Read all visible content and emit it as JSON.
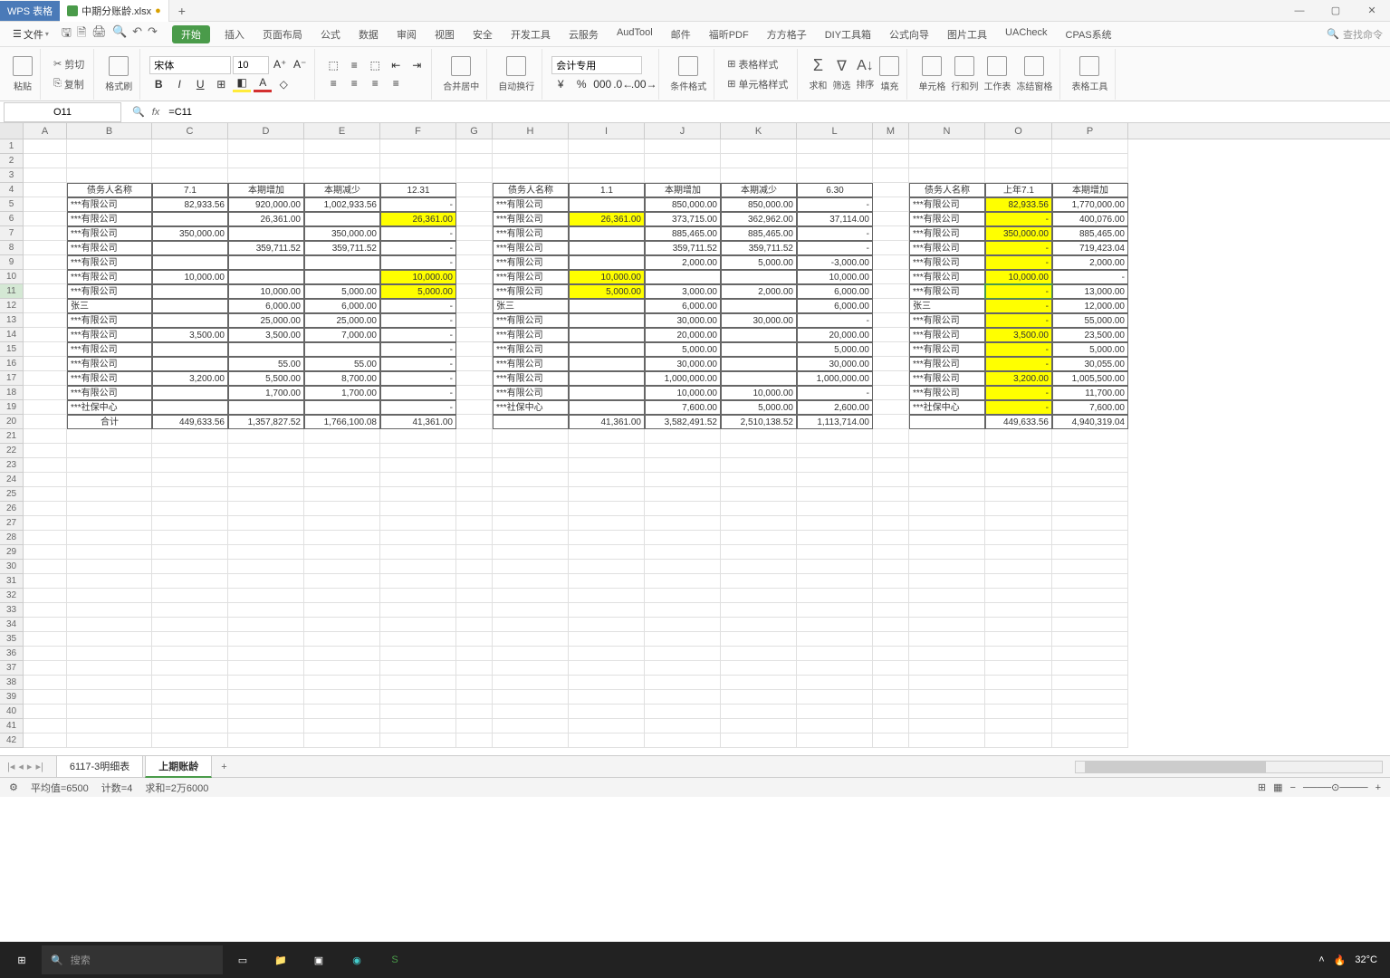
{
  "app": {
    "name": "WPS 表格",
    "file": "中期分账龄.xlsx"
  },
  "menu": {
    "file": "文件",
    "tabs": [
      "开始",
      "插入",
      "页面布局",
      "公式",
      "数据",
      "审阅",
      "视图",
      "安全",
      "开发工具",
      "云服务",
      "AudTool",
      "邮件",
      "福昕PDF",
      "方方格子",
      "DIY工具箱",
      "公式向导",
      "图片工具",
      "UACheck",
      "CPAS系统"
    ],
    "active": 0,
    "search": "查找命令"
  },
  "ribbon": {
    "paste": "粘贴",
    "cut": "剪切",
    "copy": "复制",
    "fmtpaint": "格式刷",
    "font_name": "宋体",
    "font_size": "10",
    "merge": "合并居中",
    "wrap": "自动换行",
    "num_fmt": "会计专用",
    "cond": "条件格式",
    "tblsty": "表格样式",
    "cellsty": "单元格样式",
    "sum": "求和",
    "filter": "筛选",
    "sort": "排序",
    "fill": "填充",
    "cell": "单元格",
    "rowcol": "行和列",
    "sheet": "工作表",
    "freeze": "冻结窗格",
    "tbltools": "表格工具"
  },
  "namebox": "O11",
  "formula": "=C11",
  "cols": [
    "A",
    "B",
    "C",
    "D",
    "E",
    "F",
    "G",
    "H",
    "I",
    "J",
    "K",
    "L",
    "M",
    "N",
    "O",
    "P"
  ],
  "rows": 42,
  "activeRow": 11,
  "hdr1": {
    "B": "债务人名称",
    "C": "7.1",
    "D": "本期增加",
    "E": "本期减少",
    "F": "12.31"
  },
  "hdr2": {
    "H": "债务人名称",
    "I": "1.1",
    "J": "本期增加",
    "K": "本期减少",
    "L": "6.30"
  },
  "hdr3": {
    "N": "债务人名称",
    "O": "上年7.1",
    "P": "本期增加"
  },
  "t1": [
    {
      "b": "***有限公司",
      "c": "82,933.56",
      "d": "920,000.00",
      "e": "1,002,933.56",
      "f": "-"
    },
    {
      "b": "***有限公司",
      "c": "",
      "d": "26,361.00",
      "e": "",
      "f": "26,361.00",
      "fy": true
    },
    {
      "b": "***有限公司",
      "c": "350,000.00",
      "d": "",
      "e": "350,000.00",
      "f": "-"
    },
    {
      "b": "***有限公司",
      "c": "",
      "d": "359,711.52",
      "e": "359,711.52",
      "f": "-"
    },
    {
      "b": "***有限公司",
      "c": "",
      "d": "",
      "e": "",
      "f": "-"
    },
    {
      "b": "***有限公司",
      "c": "10,000.00",
      "d": "",
      "e": "",
      "f": "10,000.00",
      "fy": true
    },
    {
      "b": "***有限公司",
      "c": "",
      "d": "10,000.00",
      "e": "5,000.00",
      "f": "5,000.00",
      "fy": true
    },
    {
      "b": "张三",
      "c": "",
      "d": "6,000.00",
      "e": "6,000.00",
      "f": "-"
    },
    {
      "b": "***有限公司",
      "c": "",
      "d": "25,000.00",
      "e": "25,000.00",
      "f": "-"
    },
    {
      "b": "***有限公司",
      "c": "3,500.00",
      "d": "3,500.00",
      "e": "7,000.00",
      "f": "-"
    },
    {
      "b": "***有限公司",
      "c": "",
      "d": "",
      "e": "",
      "f": "-"
    },
    {
      "b": "***有限公司",
      "c": "",
      "d": "55.00",
      "e": "55.00",
      "f": "-"
    },
    {
      "b": "***有限公司",
      "c": "3,200.00",
      "d": "5,500.00",
      "e": "8,700.00",
      "f": "-"
    },
    {
      "b": "***有限公司",
      "c": "",
      "d": "1,700.00",
      "e": "1,700.00",
      "f": "-"
    },
    {
      "b": "***社保中心",
      "c": "",
      "d": "",
      "e": "",
      "f": "-"
    },
    {
      "b": "合计",
      "c": "449,633.56",
      "d": "1,357,827.52",
      "e": "1,766,100.08",
      "f": "41,361.00"
    }
  ],
  "t2": [
    {
      "h": "***有限公司",
      "i": "",
      "j": "850,000.00",
      "k": "850,000.00",
      "l": "-"
    },
    {
      "h": "***有限公司",
      "i": "26,361.00",
      "iy": true,
      "j": "373,715.00",
      "k": "362,962.00",
      "l": "37,114.00"
    },
    {
      "h": "***有限公司",
      "i": "",
      "j": "885,465.00",
      "k": "885,465.00",
      "l": "-"
    },
    {
      "h": "***有限公司",
      "i": "",
      "j": "359,711.52",
      "k": "359,711.52",
      "l": "-"
    },
    {
      "h": "***有限公司",
      "i": "",
      "j": "2,000.00",
      "k": "5,000.00",
      "l": "-3,000.00"
    },
    {
      "h": "***有限公司",
      "i": "10,000.00",
      "iy": true,
      "j": "",
      "k": "",
      "l": "10,000.00"
    },
    {
      "h": "***有限公司",
      "i": "5,000.00",
      "iy": true,
      "j": "3,000.00",
      "k": "2,000.00",
      "l": "6,000.00"
    },
    {
      "h": "张三",
      "i": "",
      "j": "6,000.00",
      "k": "",
      "l": "6,000.00"
    },
    {
      "h": "***有限公司",
      "i": "",
      "j": "30,000.00",
      "k": "30,000.00",
      "l": "-"
    },
    {
      "h": "***有限公司",
      "i": "",
      "j": "20,000.00",
      "k": "",
      "l": "20,000.00"
    },
    {
      "h": "***有限公司",
      "i": "",
      "j": "5,000.00",
      "k": "",
      "l": "5,000.00"
    },
    {
      "h": "***有限公司",
      "i": "",
      "j": "30,000.00",
      "k": "",
      "l": "30,000.00"
    },
    {
      "h": "***有限公司",
      "i": "",
      "j": "1,000,000.00",
      "k": "",
      "l": "1,000,000.00"
    },
    {
      "h": "***有限公司",
      "i": "",
      "j": "10,000.00",
      "k": "10,000.00",
      "l": "-"
    },
    {
      "h": "***社保中心",
      "i": "",
      "j": "7,600.00",
      "k": "5,000.00",
      "l": "2,600.00"
    },
    {
      "h": "",
      "i": "41,361.00",
      "j": "3,582,491.52",
      "k": "2,510,138.52",
      "l": "1,113,714.00"
    }
  ],
  "t3": [
    {
      "n": "***有限公司",
      "o": "82,933.56",
      "oy": true,
      "p": "1,770,000.00"
    },
    {
      "n": "***有限公司",
      "o": "-",
      "oy": true,
      "p": "400,076.00"
    },
    {
      "n": "***有限公司",
      "o": "350,000.00",
      "oy": true,
      "p": "885,465.00"
    },
    {
      "n": "***有限公司",
      "o": "-",
      "oy": true,
      "p": "719,423.04"
    },
    {
      "n": "***有限公司",
      "o": "-",
      "oy": true,
      "p": "2,000.00"
    },
    {
      "n": "***有限公司",
      "o": "10,000.00",
      "oy": true,
      "p": "-"
    },
    {
      "n": "***有限公司",
      "o": "-",
      "oy": true,
      "p": "13,000.00"
    },
    {
      "n": "张三",
      "o": "-",
      "oy": true,
      "p": "12,000.00"
    },
    {
      "n": "***有限公司",
      "o": "-",
      "oy": true,
      "p": "55,000.00"
    },
    {
      "n": "***有限公司",
      "o": "3,500.00",
      "oy": true,
      "p": "23,500.00"
    },
    {
      "n": "***有限公司",
      "o": "-",
      "oy": true,
      "p": "5,000.00"
    },
    {
      "n": "***有限公司",
      "o": "-",
      "oy": true,
      "p": "30,055.00"
    },
    {
      "n": "***有限公司",
      "o": "3,200.00",
      "oy": true,
      "p": "1,005,500.00"
    },
    {
      "n": "***有限公司",
      "o": "-",
      "oy": true,
      "p": "11,700.00"
    },
    {
      "n": "***社保中心",
      "o": "-",
      "oy": true,
      "p": "7,600.00"
    },
    {
      "n": "",
      "o": "449,633.56",
      "p": "4,940,319.04"
    }
  ],
  "sheets": {
    "list": [
      "6117-3明细表",
      "上期账龄"
    ],
    "active": 1
  },
  "status": {
    "avg": "平均值=6500",
    "cnt": "计数=4",
    "sum": "求和=2万6000"
  },
  "taskbar": {
    "search": "搜索",
    "temp": "32°C"
  }
}
